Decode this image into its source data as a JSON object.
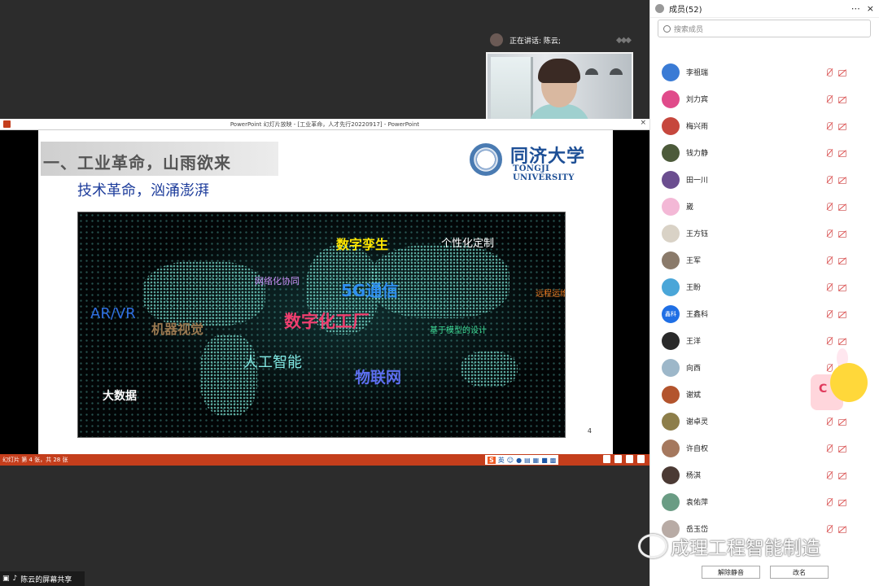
{
  "speaker": {
    "now_speaking": "正在讲话: 陈云;",
    "video_name": "陈云"
  },
  "ppt": {
    "window_title": "PowerPoint 幻灯片放映 - [工业革命，人才先行20220917] - PowerPoint",
    "close_glyph": "×",
    "status_text": "幻灯片 第 4 张，共 28 张",
    "ime_lang": "英"
  },
  "slide": {
    "title": "一、工业革命，山雨欲来",
    "subtitle": "技术革命，汹涌澎湃",
    "university_cn": "同济大学",
    "university_en": "TONGJI UNIVERSITY",
    "page_number": "4",
    "keywords": [
      {
        "text": "数字孪生",
        "color": "#ffe600"
      },
      {
        "text": "个性化定制",
        "color": "#ffffff"
      },
      {
        "text": "网络化协同",
        "color": "#c88df5"
      },
      {
        "text": "5G通信",
        "color": "#2f8ff0"
      },
      {
        "text": "远程运维",
        "color": "#f07b20"
      },
      {
        "text": "AR/VR",
        "color": "#2f6fe0"
      },
      {
        "text": "机器视觉",
        "color": "#9a7850"
      },
      {
        "text": "数字化工厂",
        "color": "#ef3e6f"
      },
      {
        "text": "基于模型的设计",
        "color": "#3fe09a"
      },
      {
        "text": "人工智能",
        "color": "#7fe5e0"
      },
      {
        "text": "物联网",
        "color": "#5d6ff0"
      },
      {
        "text": "大数据",
        "color": "#ffffff"
      }
    ]
  },
  "share_label": "陈云的屏幕共享",
  "members": {
    "header": "成员(52)",
    "search_placeholder": "搜索成员",
    "list": [
      {
        "name": "李祖瑞",
        "avatar_color": "#3a7bd5"
      },
      {
        "name": "刘力宾",
        "avatar_color": "#e04b8a"
      },
      {
        "name": "梅兴雨",
        "avatar_color": "#c6473d"
      },
      {
        "name": "钱力静",
        "avatar_color": "#4c5a3a"
      },
      {
        "name": "田一川",
        "avatar_color": "#6b4e8f"
      },
      {
        "name": "崴",
        "avatar_color": "#f3b8d6"
      },
      {
        "name": "王方钰",
        "avatar_color": "#d9d2c6"
      },
      {
        "name": "王军",
        "avatar_color": "#8a7a6a"
      },
      {
        "name": "王盼",
        "avatar_color": "#4aa6d8"
      },
      {
        "name": "王鑫科",
        "avatar_color": "#1f6fe5",
        "avatar_text": "鑫科"
      },
      {
        "name": "王洋",
        "avatar_color": "#2a2a2a"
      },
      {
        "name": "向西",
        "avatar_color": "#9db7c9"
      },
      {
        "name": "谢斌",
        "avatar_color": "#b3542d"
      },
      {
        "name": "谢卓灵",
        "avatar_color": "#8d7e4a"
      },
      {
        "name": "许自权",
        "avatar_color": "#a5785e"
      },
      {
        "name": "杨淇",
        "avatar_color": "#4b3a34"
      },
      {
        "name": "袁佑萍",
        "avatar_color": "#6a9c84"
      },
      {
        "name": "岳玉岱",
        "avatar_color": "#b8aba5"
      }
    ],
    "unmute_all": "解除静音",
    "rename": "改名"
  },
  "watermark": "成理工程智能制造"
}
